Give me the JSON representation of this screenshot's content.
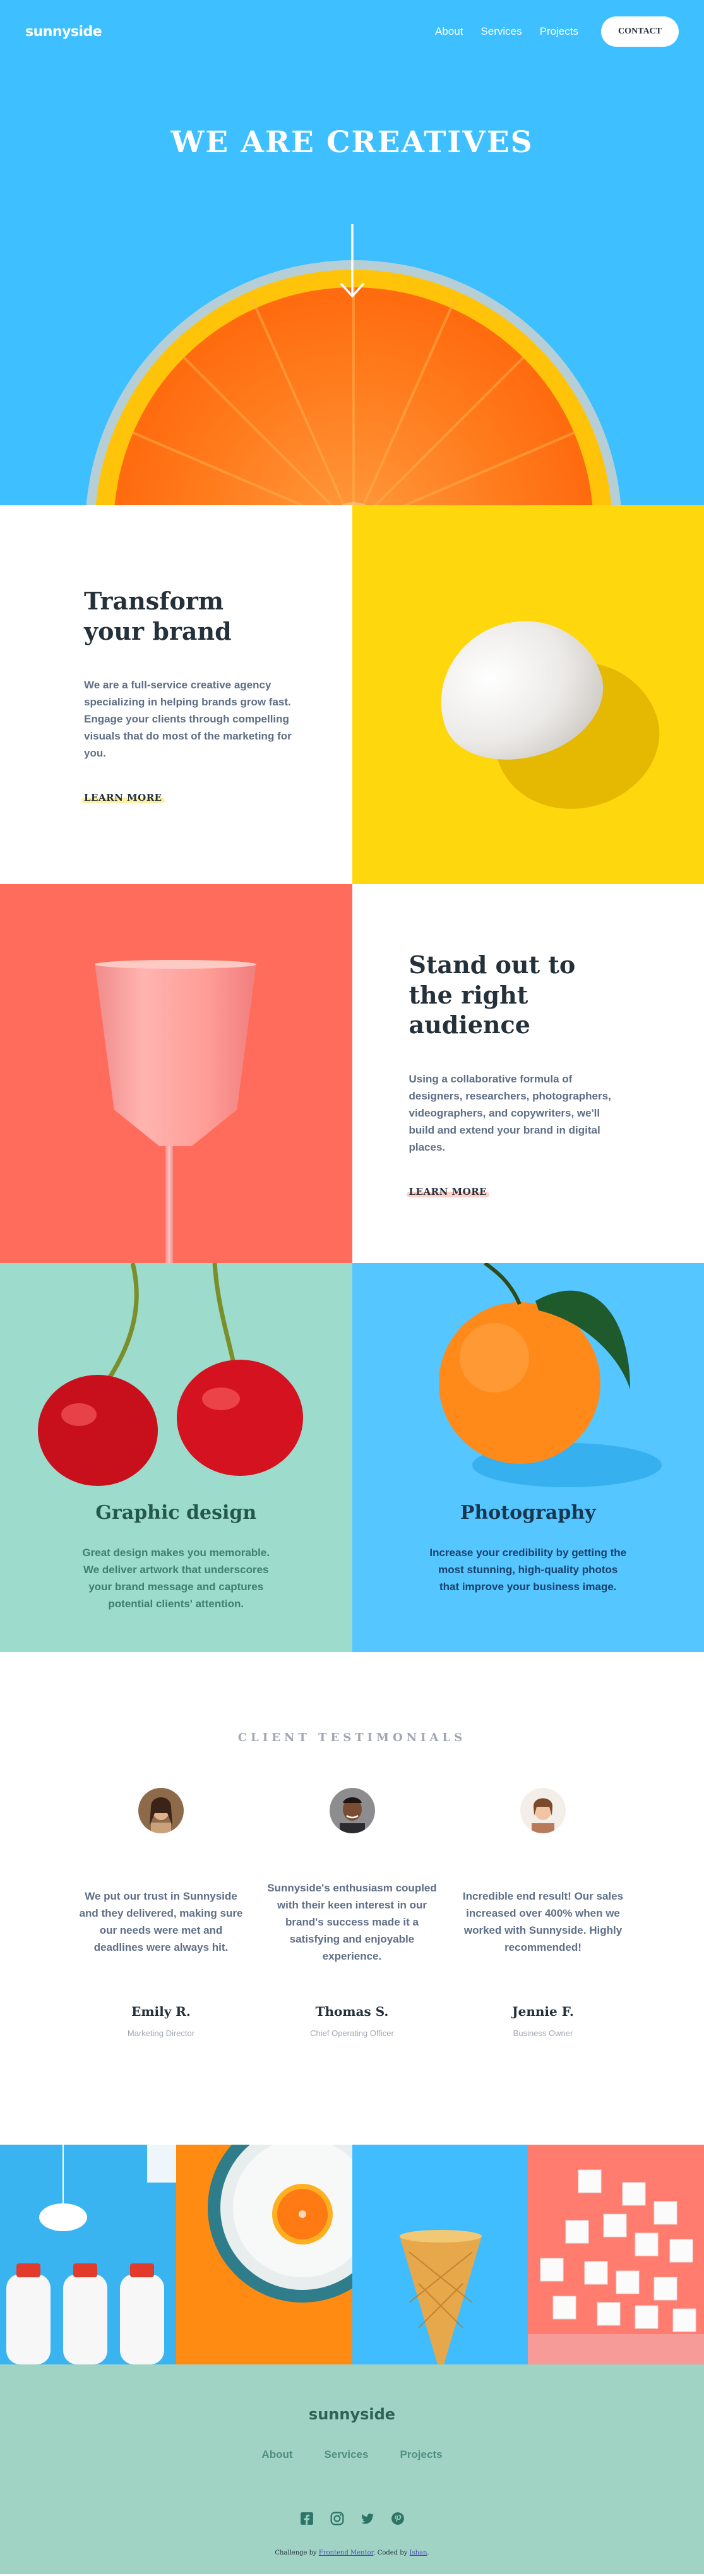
{
  "nav": {
    "logo": "sunnyside",
    "links": [
      "About",
      "Services",
      "Projects"
    ],
    "cta": "Contact"
  },
  "hero": {
    "title": "WE ARE CREATIVES"
  },
  "brand": {
    "title": "Transform your brand",
    "body": "We are a full-service creative agency specializing in helping brands grow fast. Engage your clients through compelling visuals that do most of the marketing for you.",
    "link": "LEARN MORE",
    "highlight_color": "#fad400"
  },
  "audience": {
    "title": "Stand out to the right audience",
    "body": "Using a collaborative formula of designers, researchers, photographers, videographers, and copywriters, we'll build and extend your brand in digital places.",
    "link": "LEARN MORE",
    "highlight_color": "#fe7865"
  },
  "services": [
    {
      "title": "Graphic design",
      "body": "Great design makes you memorable. We deliver artwork that underscores your brand message and captures potential clients' attention."
    },
    {
      "title": "Photography",
      "body": "Increase your credibility by getting the most stunning, high-quality photos that improve your business image."
    }
  ],
  "testimonials": {
    "heading": "CLIENT TESTIMONIALS",
    "items": [
      {
        "quote": "We put our trust in Sunnyside and they delivered, making sure our needs were met and deadlines were always hit.",
        "name": "Emily R.",
        "role": "Marketing Director"
      },
      {
        "quote": "Sunnyside's enthusiasm coupled with their keen interest in our brand's success made it a satisfying and enjoyable experience.",
        "name": "Thomas S.",
        "role": "Chief Operating Officer"
      },
      {
        "quote": "Incredible end result! Our sales increased over 400% when we worked with Sunnyside. Highly recommended!",
        "name": "Jennie F.",
        "role": "Business Owner"
      }
    ]
  },
  "footer": {
    "logo": "sunnyside",
    "links": [
      "About",
      "Services",
      "Projects"
    ],
    "social_icons": [
      "facebook-icon",
      "instagram-icon",
      "twitter-icon",
      "pinterest-icon"
    ],
    "credit_prefix": "Challenge by",
    "credit_link1": "Frontend Mentor",
    "credit_mid": ". Coded by",
    "credit_link2": "Ishan",
    "credit_suffix": "."
  }
}
